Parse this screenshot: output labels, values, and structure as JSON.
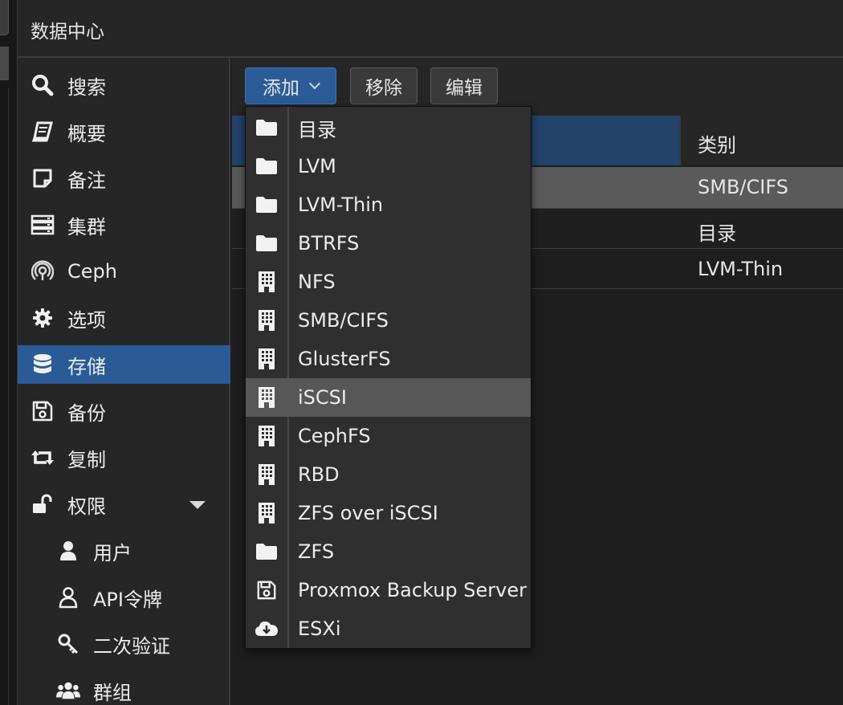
{
  "header": {
    "title": "数据中心"
  },
  "sidebar": {
    "items": [
      {
        "label": "搜索",
        "icon": "search-icon"
      },
      {
        "label": "概要",
        "icon": "book-icon"
      },
      {
        "label": "备注",
        "icon": "sticky-note-icon"
      },
      {
        "label": "集群",
        "icon": "server-rack-icon"
      },
      {
        "label": "Ceph",
        "icon": "ceph-icon"
      },
      {
        "label": "选项",
        "icon": "gear-icon"
      },
      {
        "label": "存储",
        "icon": "database-icon",
        "active": true
      },
      {
        "label": "备份",
        "icon": "floppy-disk-icon"
      },
      {
        "label": "复制",
        "icon": "retweet-icon"
      },
      {
        "label": "权限",
        "icon": "unlock-icon",
        "expanded": true
      },
      {
        "label": "用户",
        "icon": "user-icon"
      },
      {
        "label": "API令牌",
        "icon": "user-outline-icon"
      },
      {
        "label": "二次验证",
        "icon": "key-icon"
      },
      {
        "label": "群组",
        "icon": "users-icon"
      }
    ]
  },
  "toolbar": {
    "add_label": "添加",
    "remove_label": "移除",
    "edit_label": "编辑"
  },
  "grid": {
    "columns": {
      "type": "类别"
    },
    "rows": [
      {
        "type": "SMB/CIFS"
      },
      {
        "type": "目录"
      },
      {
        "type": "LVM-Thin"
      }
    ]
  },
  "add_menu": {
    "items": [
      {
        "label": "目录",
        "icon": "folder-icon"
      },
      {
        "label": "LVM",
        "icon": "folder-icon"
      },
      {
        "label": "LVM-Thin",
        "icon": "folder-icon"
      },
      {
        "label": "BTRFS",
        "icon": "folder-icon"
      },
      {
        "label": "NFS",
        "icon": "building-icon"
      },
      {
        "label": "SMB/CIFS",
        "icon": "building-icon"
      },
      {
        "label": "GlusterFS",
        "icon": "building-icon"
      },
      {
        "label": "iSCSI",
        "icon": "building-icon",
        "highlighted": true
      },
      {
        "label": "CephFS",
        "icon": "building-icon"
      },
      {
        "label": "RBD",
        "icon": "building-icon"
      },
      {
        "label": "ZFS over iSCSI",
        "icon": "building-icon"
      },
      {
        "label": "ZFS",
        "icon": "folder-icon"
      },
      {
        "label": "Proxmox Backup Server",
        "icon": "floppy-disk-icon"
      },
      {
        "label": "ESXi",
        "icon": "cloud-download-icon"
      }
    ]
  },
  "colors": {
    "accent": "#2a5b96",
    "background": "#1e1e1e",
    "panel": "#262626",
    "menu": "#2f2f2f",
    "highlight": "#575757"
  }
}
